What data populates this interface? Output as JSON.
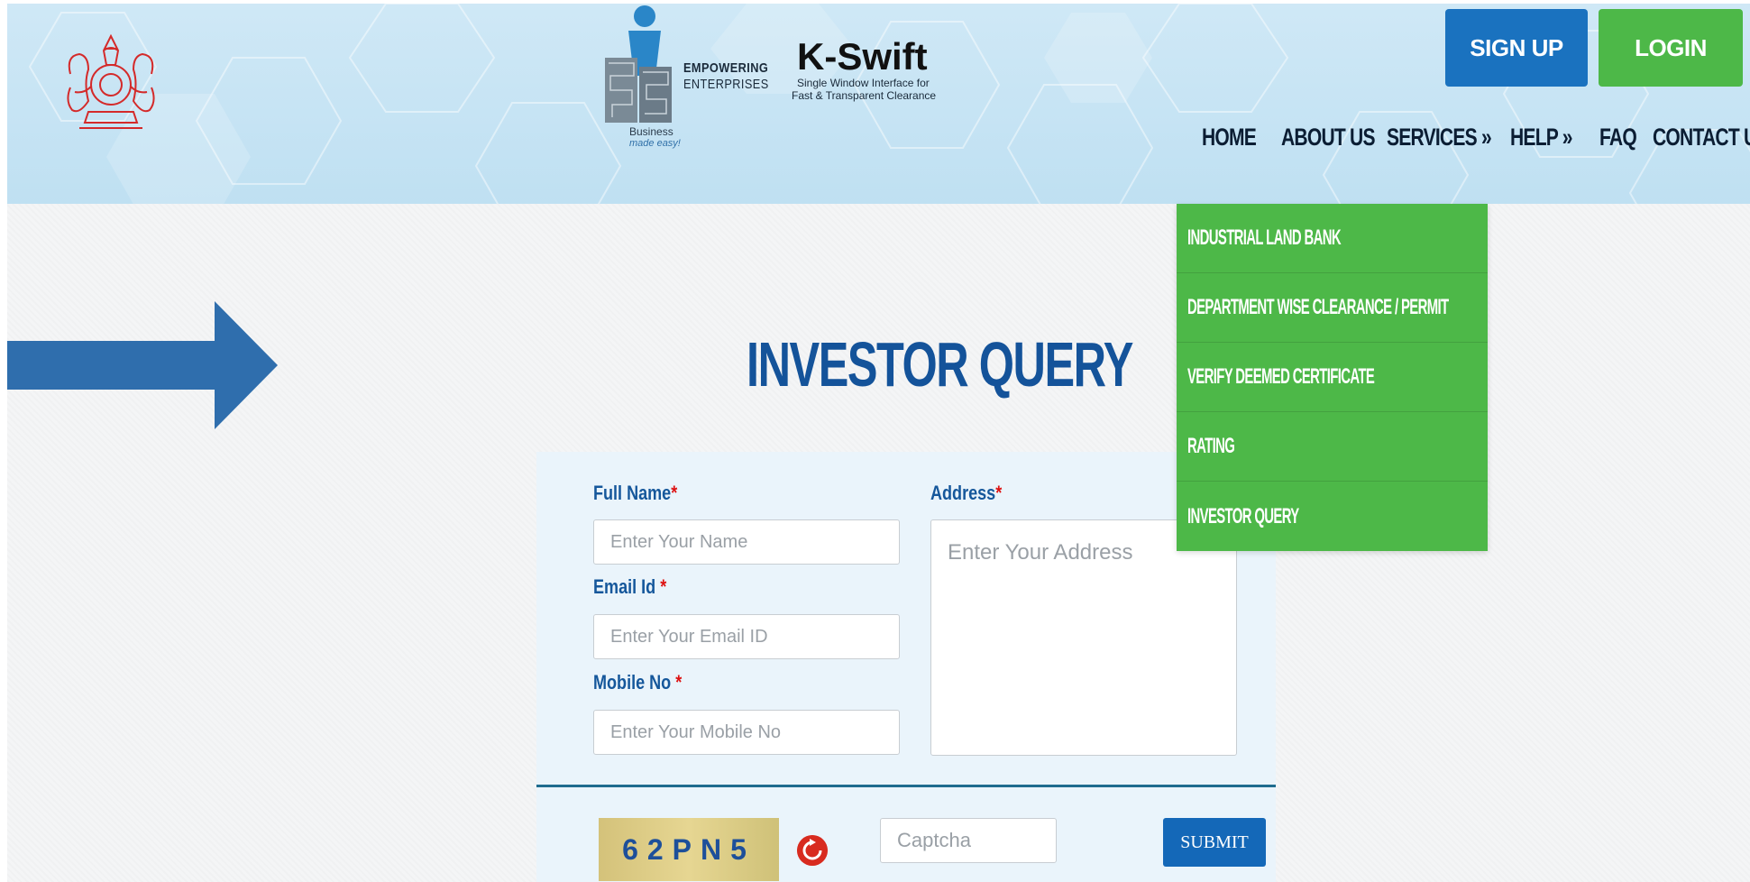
{
  "header": {
    "brand": {
      "empowering": "EMPOWERING",
      "enterprises": "ENTERPRISES",
      "name": "K-Swift",
      "tagline_line1": "Single Window Interface for",
      "tagline_line2": "Fast & Transparent Clearance",
      "business": "Business",
      "made_easy": "made easy!"
    },
    "signup_label": "SIGN UP",
    "login_label": "LOGIN",
    "nav": [
      {
        "label": "HOME"
      },
      {
        "label": "ABOUT US"
      },
      {
        "label": "SERVICES »"
      },
      {
        "label": "HELP »"
      },
      {
        "label": "FAQ"
      },
      {
        "label": "CONTACT US"
      }
    ]
  },
  "services_menu": {
    "items": [
      {
        "label": "INDUSTRIAL LAND BANK"
      },
      {
        "label": "DEPARTMENT WISE CLEARANCE / PERMIT"
      },
      {
        "label": "VERIFY DEEMED CERTIFICATE"
      },
      {
        "label": "RATING"
      },
      {
        "label": "INVESTOR QUERY"
      }
    ]
  },
  "page": {
    "title": "INVESTOR QUERY"
  },
  "form": {
    "full_name_label": "Full Name",
    "full_name_placeholder": "Enter Your Name",
    "email_label": "Email Id ",
    "email_placeholder": "Enter Your Email ID",
    "mobile_label": "Mobile No ",
    "mobile_placeholder": "Enter Your Mobile No",
    "address_label": "Address",
    "address_placeholder": "Enter Your Address",
    "required_mark": "*",
    "captcha_text": "62PN5",
    "captcha_placeholder": "Captcha",
    "submit_label": "SUBMIT"
  },
  "colors": {
    "signup": "#1a72bf",
    "login": "#4db848",
    "title": "#14539a",
    "arrow": "#2f6ead"
  },
  "icons": {
    "refresh": "refresh-icon",
    "arrow": "right-arrow-icon",
    "emblem": "kerala-emblem-icon"
  }
}
